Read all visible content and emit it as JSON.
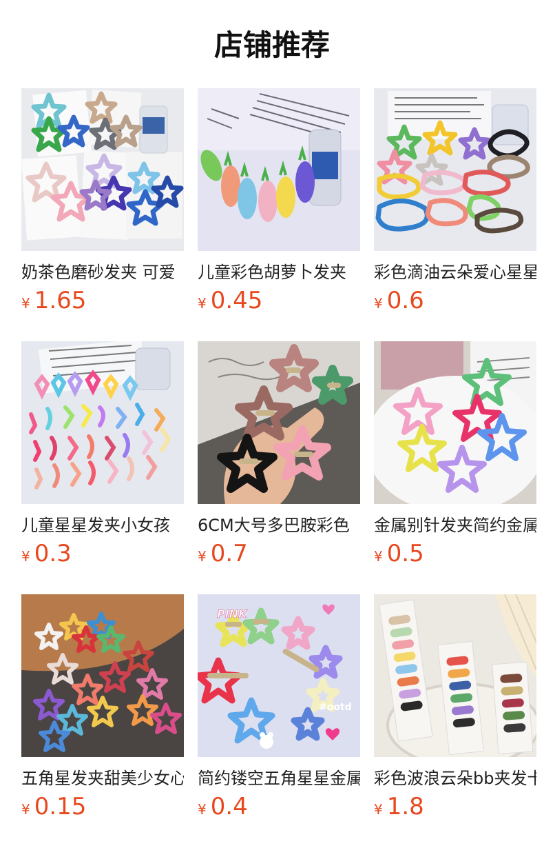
{
  "page": {
    "title": "店铺推荐"
  },
  "products": [
    {
      "name": "奶茶色磨砂发夹 可爱",
      "currency": "¥",
      "price": "1.65",
      "image": "star-hair-clips-on-cards"
    },
    {
      "name": "儿童彩色胡萝卜发夹",
      "currency": "¥",
      "price": "0.45",
      "image": "carrot-hair-clips"
    },
    {
      "name": "彩色滴油云朵爱心星星",
      "currency": "¥",
      "price": "0.6",
      "image": "cloud-heart-star-clips"
    },
    {
      "name": "儿童星星发夹小女孩",
      "currency": "¥",
      "price": "0.3",
      "image": "assorted-kids-clips"
    },
    {
      "name": "6CM大号多巴胺彩色",
      "currency": "¥",
      "price": "0.7",
      "image": "large-star-clips-in-hand"
    },
    {
      "name": "金属别针发夹简约金属",
      "currency": "¥",
      "price": "0.5",
      "image": "hollow-star-clips-on-plate"
    },
    {
      "name": "五角星发夹甜美少女心",
      "currency": "¥",
      "price": "0.15",
      "image": "star-clips-on-wood"
    },
    {
      "name": "简约镂空五角星星金属",
      "currency": "¥",
      "price": "0.4",
      "image": "pink-hollow-star-clips"
    },
    {
      "name": "彩色波浪云朵bb夹发卡",
      "currency": "¥",
      "price": "1.8",
      "image": "wave-bb-clips-set"
    }
  ]
}
